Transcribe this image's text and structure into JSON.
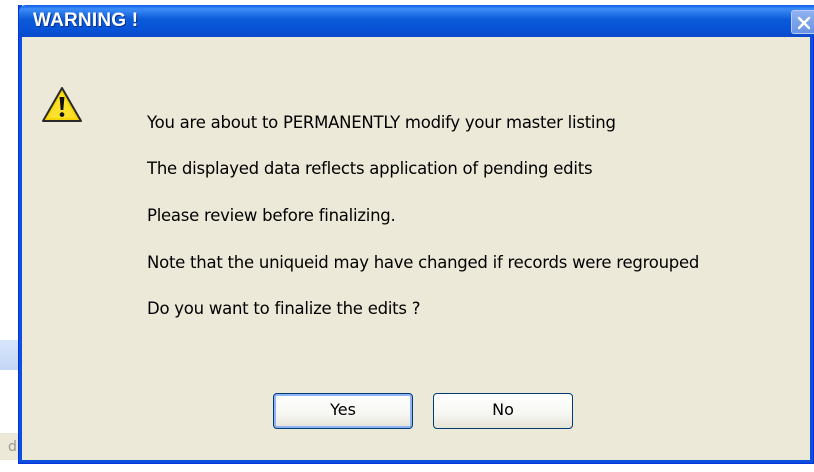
{
  "dialog": {
    "title": "WARNING !",
    "icon": "warning-icon",
    "messages": [
      "You are about to PERMANENTLY modify your master listing",
      "The displayed data reflects application of pending edits",
      "Please review before finalizing.",
      "Note that the uniqueid may have changed if records were regrouped",
      "Do you want to finalize the edits ?"
    ],
    "buttons": {
      "yes": "Yes",
      "no": "No"
    }
  },
  "background": {
    "tab_label": "dito"
  },
  "colors": {
    "title_bar": "#0a5fe8",
    "dialog_face": "#ece9d8",
    "warning_yellow": "#f5d400"
  }
}
